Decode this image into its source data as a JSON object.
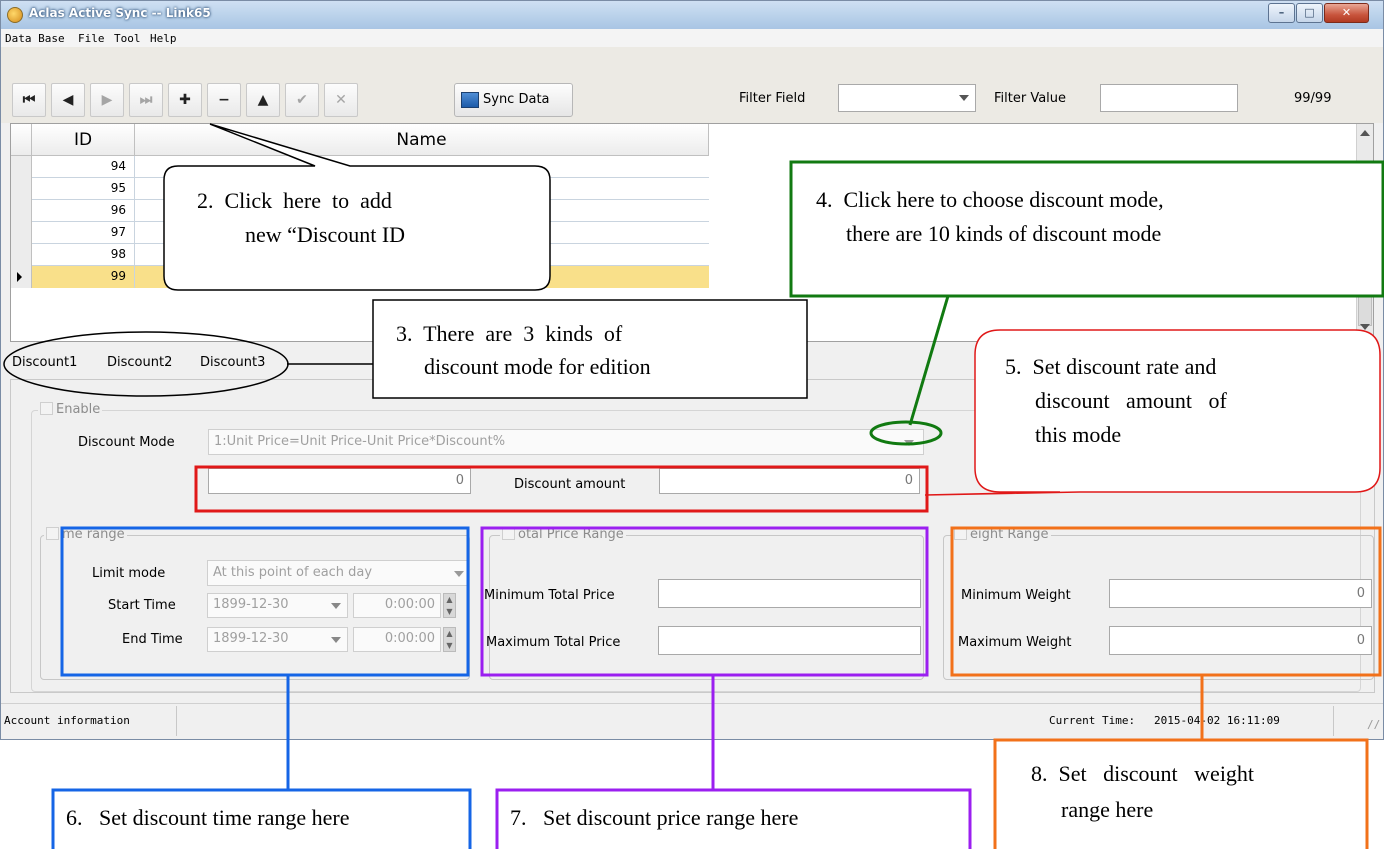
{
  "window": {
    "title": "Aclas Active Sync -- Link65"
  },
  "menu": [
    "Data Base",
    "File",
    "Tool",
    "Help"
  ],
  "toolbar": {
    "nav_icons": [
      "first-record-icon",
      "prev-record-icon",
      "next-record-icon",
      "last-record-icon",
      "add-record-icon",
      "delete-record-icon",
      "up-icon",
      "post-icon",
      "cancel-icon"
    ],
    "nav_glyphs": [
      "⏮",
      "◀",
      "▶",
      "⏭",
      "✚",
      "−",
      "▲",
      "✔",
      "✕"
    ],
    "sync_label": "Sync Data",
    "filter_field_label": "Filter Field",
    "filter_field_value": "",
    "filter_value_label": "Filter Value",
    "filter_value_value": "",
    "record_count": "99/99"
  },
  "grid": {
    "columns": [
      "ID",
      "Name"
    ],
    "rows": [
      {
        "id": "94",
        "name": ""
      },
      {
        "id": "95",
        "name": ""
      },
      {
        "id": "96",
        "name": ""
      },
      {
        "id": "97",
        "name": ""
      },
      {
        "id": "98",
        "name": ""
      },
      {
        "id": "99",
        "name": ""
      }
    ],
    "selected_id": "99"
  },
  "tabs": [
    "Discount1",
    "Discount2",
    "Discount3"
  ],
  "discount": {
    "enable_label": "Enable",
    "mode_label": "Discount Mode",
    "mode_value": "1:Unit Price=Unit Price-Unit Price*Discount%",
    "rate_value": "0",
    "amount_label": "Discount amount",
    "amount_value": "0"
  },
  "time_range": {
    "title": "me range",
    "limit_label": "Limit mode",
    "limit_value": "At this point of each day",
    "start_label": "Start Time",
    "start_date": "1899-12-30",
    "start_time": "0:00:00",
    "end_label": "End Time",
    "end_date": "1899-12-30",
    "end_time": "0:00:00"
  },
  "price_range": {
    "title": "otal Price Range",
    "min_label": "Minimum Total Price",
    "min_value": "",
    "max_label": "Maximum Total Price",
    "max_value": ""
  },
  "weight_range": {
    "title": "eight Range",
    "min_label": "Minimum Weight",
    "min_value": "0",
    "max_label": "Maximum Weight",
    "max_value": "0"
  },
  "status": {
    "account": "Account information",
    "time_label": "Current Time:",
    "time_value": "2015-04-02 16:11:09"
  },
  "annotations": {
    "a2_line1": "2.  Click  here  to  add",
    "a2_line2": "new “Discount ID",
    "a3_line1": "3.  There  are  3  kinds  of",
    "a3_line2": "discount mode for edition",
    "a4_line1": "4.  Click here to choose discount mode,",
    "a4_line2": "there are 10 kinds of discount mode",
    "a5_line1": "5.  Set discount rate and",
    "a5_line2": "discount   amount   of",
    "a5_line3": "this mode",
    "a6": "6.   Set discount time range here",
    "a7": "7.   Set discount price range here",
    "a8_line1": "8.  Set   discount   weight",
    "a8_line2": "range here"
  },
  "colors": {
    "green": "#117a11",
    "red": "#e01818",
    "blue": "#1565e6",
    "purple": "#9b1ff0",
    "orange": "#f2711a",
    "selected_row": "#f9e08a"
  }
}
